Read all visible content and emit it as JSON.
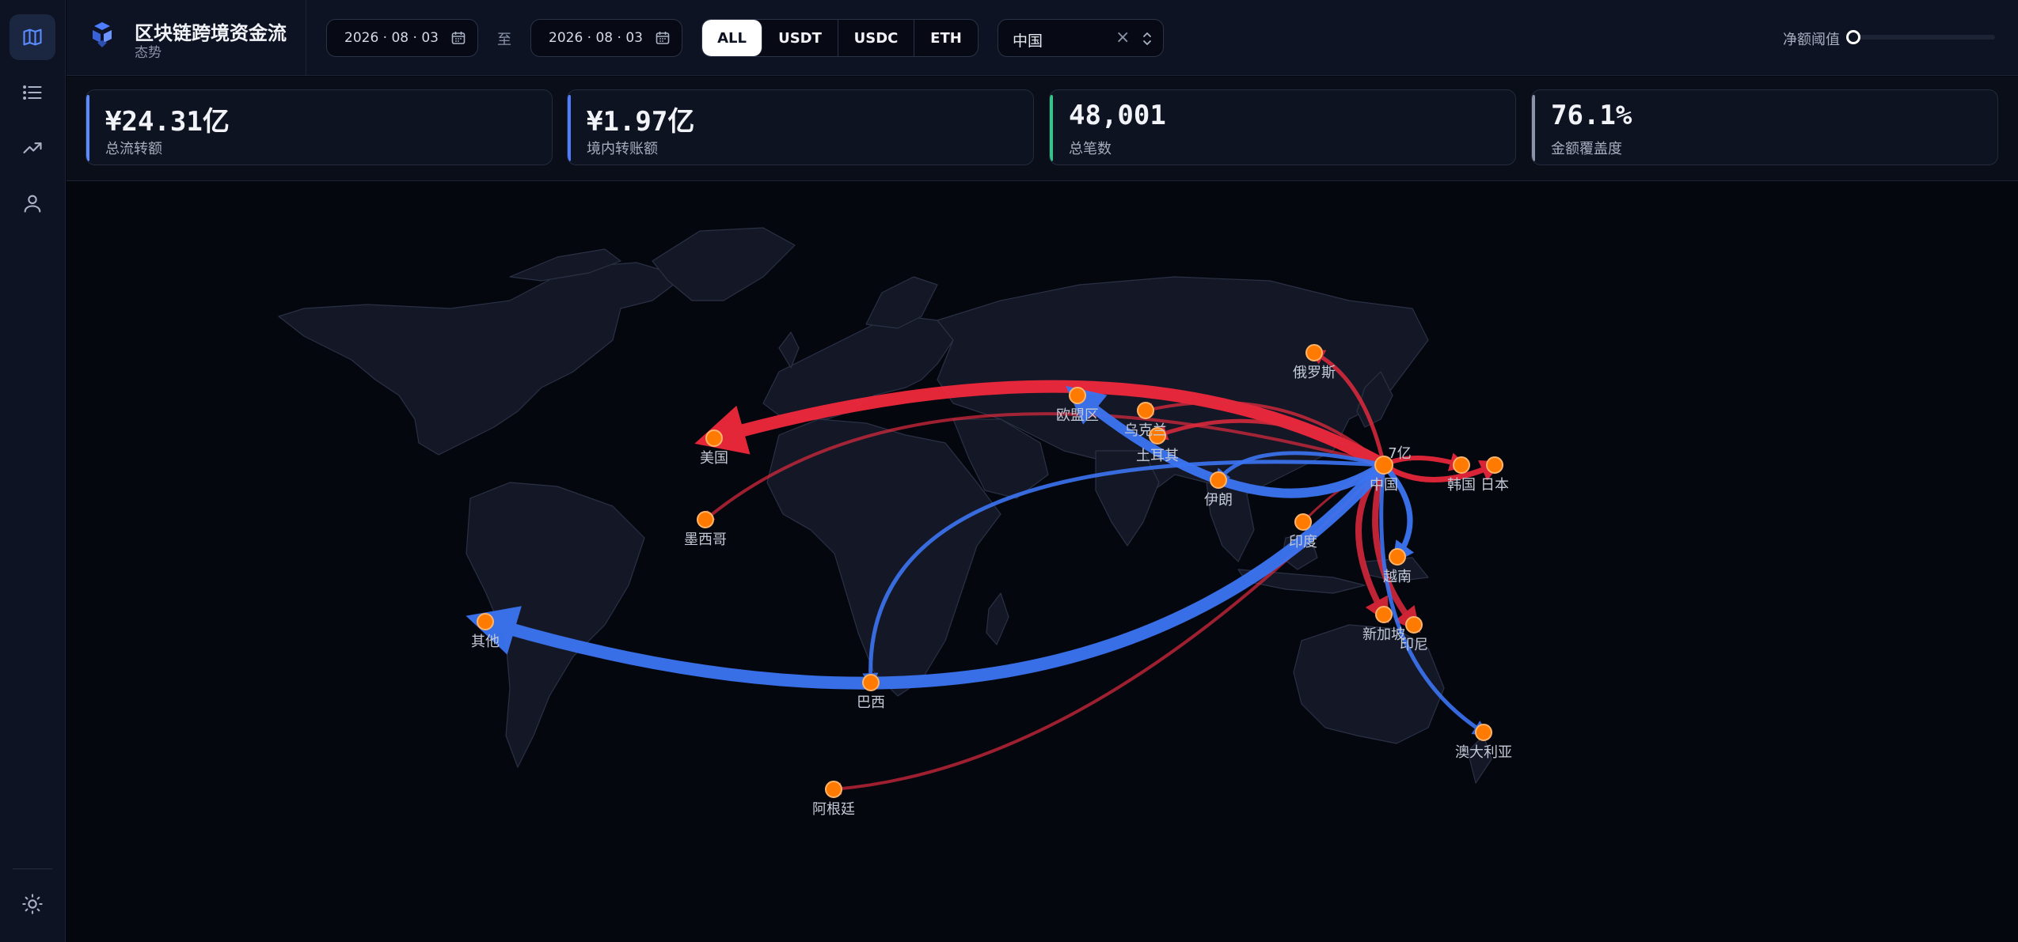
{
  "sidebar": {
    "items": [
      {
        "icon": "map-icon",
        "active": true
      },
      {
        "icon": "list-icon",
        "active": false
      },
      {
        "icon": "trend-icon",
        "active": false
      },
      {
        "icon": "user-icon",
        "active": false
      }
    ],
    "bottom_icon": "sun-icon"
  },
  "header": {
    "title": "区块链跨境资金流",
    "subtitle": "态势",
    "date_from": "2026 · 08 · 03",
    "date_sep": "至",
    "date_to": "2026 · 08 · 03",
    "assets": [
      "ALL",
      "USDT",
      "USDC",
      "ETH"
    ],
    "active_asset": "ALL",
    "region_value": "中国",
    "region_clear": "×",
    "threshold_label": "净额阈值",
    "threshold_value": "0万",
    "threshold_fraction": 0
  },
  "kpis": [
    {
      "value": "¥24.31亿",
      "label": "总流转额",
      "color": "#5b8cff"
    },
    {
      "value": "¥1.97亿",
      "label": "境内转账额",
      "color": "#4f7dff"
    },
    {
      "value": "48,001",
      "label": "总笔数",
      "color": "#35c48a"
    },
    {
      "value": "76.1%",
      "label": "金额覆盖度",
      "color": "#8a93a8"
    }
  ],
  "map": {
    "hub": "中国",
    "hub_value_label": "7亿",
    "colors": {
      "outflow": "#f0283c",
      "inflow": "#3b74f2",
      "node": "#ff7a00",
      "land": "#141826",
      "border": "#2a3145"
    },
    "cities": [
      "美国",
      "墨西哥",
      "其他",
      "巴西",
      "阿根廷",
      "欧盟区",
      "乌克兰",
      "土耳其",
      "伊朗",
      "俄罗斯",
      "印度",
      "中国",
      "韩国",
      "日本",
      "越南",
      "新加坡",
      "印尼",
      "澳大利亚"
    ],
    "flows": [
      {
        "from": "中国",
        "to": "美国",
        "direction": "outflow",
        "strength": 5
      },
      {
        "from": "中国",
        "to": "墨西哥",
        "direction": "outflow",
        "strength": 1
      },
      {
        "from": "中国",
        "to": "其他",
        "direction": "inflow",
        "strength": 5
      },
      {
        "from": "中国",
        "to": "巴西",
        "direction": "inflow",
        "strength": 2
      },
      {
        "from": "中国",
        "to": "阿根廷",
        "direction": "outflow",
        "strength": 1
      },
      {
        "from": "中国",
        "to": "欧盟区",
        "direction": "inflow",
        "strength": 4
      },
      {
        "from": "中国",
        "to": "乌克兰",
        "direction": "outflow",
        "strength": 2
      },
      {
        "from": "中国",
        "to": "土耳其",
        "direction": "outflow",
        "strength": 2
      },
      {
        "from": "中国",
        "to": "伊朗",
        "direction": "inflow",
        "strength": 2
      },
      {
        "from": "中国",
        "to": "俄罗斯",
        "direction": "outflow",
        "strength": 2
      },
      {
        "from": "中国",
        "to": "印度",
        "direction": "outflow",
        "strength": 1
      },
      {
        "from": "中国",
        "to": "韩国",
        "direction": "outflow",
        "strength": 2
      },
      {
        "from": "中国",
        "to": "日本",
        "direction": "outflow",
        "strength": 3
      },
      {
        "from": "中国",
        "to": "越南",
        "direction": "inflow",
        "strength": 3
      },
      {
        "from": "中国",
        "to": "新加坡",
        "direction": "outflow",
        "strength": 3
      },
      {
        "from": "中国",
        "to": "印尼",
        "direction": "outflow",
        "strength": 3
      },
      {
        "from": "中国",
        "to": "澳大利亚",
        "direction": "inflow",
        "strength": 3
      }
    ]
  }
}
